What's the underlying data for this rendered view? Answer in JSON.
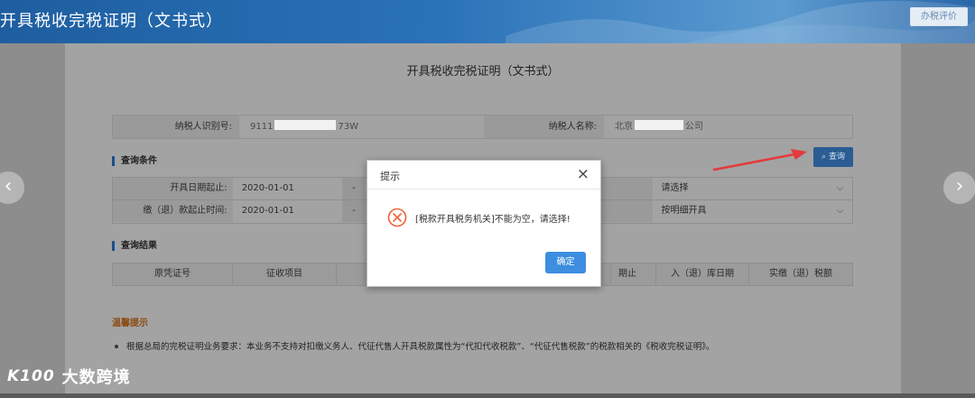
{
  "header": {
    "title": "开具税收完税证明（文书式）",
    "eval_button": "办税评价"
  },
  "page": {
    "title": "开具税收完税证明（文书式）"
  },
  "taxpayer": {
    "id_label": "纳税人识别号:",
    "id_prefix": "9111",
    "id_suffix": "73W",
    "name_label": "纳税人名称:",
    "name_prefix": "北京",
    "name_suffix": "公司"
  },
  "query": {
    "section_title": "查询条件",
    "button_label": "查询",
    "rows": [
      {
        "label": "开具日期起止:",
        "start": "2020-01-01",
        "dash": "-",
        "select": "请选择"
      },
      {
        "label": "缴（退）款起止时间:",
        "start": "2020-01-01",
        "dash": "-",
        "select": "按明细开具"
      }
    ]
  },
  "results": {
    "section_title": "查询结果",
    "columns": [
      "原凭证号",
      "征收项目",
      "",
      "",
      "期止",
      "入（退）库日期",
      "实缴（退）税额"
    ]
  },
  "tips": {
    "title": "温馨提示",
    "text": "根据总局的完税证明业务要求：本业务不支持对扣缴义务人、代征代售人开具税款属性为“代扣代收税款”、“代征代售税款”的税款相关的《税收完税证明》。"
  },
  "dialog": {
    "title": "提示",
    "close": "×",
    "message": "[税款开具税务机关]不能为空，请选择!",
    "ok_label": "确定"
  },
  "nav": {
    "prev": "‹",
    "next": "›"
  },
  "watermark": {
    "logo": "K100",
    "text": "大数跨境"
  }
}
